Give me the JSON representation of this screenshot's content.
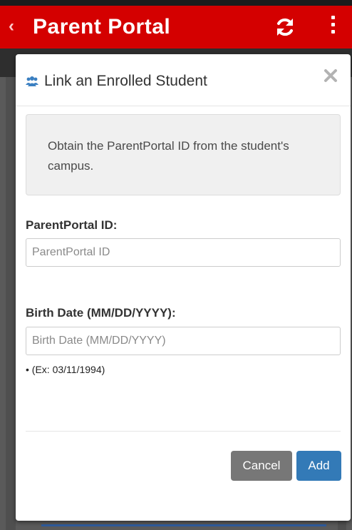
{
  "appbar": {
    "back_icon": "chevron-left-icon",
    "title": "Parent Portal",
    "refresh_icon": "refresh-icon",
    "menu_icon": "more-vertical-icon",
    "background_color": "#d40000"
  },
  "modal": {
    "header_icon": "users-icon",
    "title": "Link an Enrolled Student",
    "close_icon": "close-icon",
    "info_text": "Obtain the ParentPortal ID from the student's campus.",
    "fields": [
      {
        "label": "ParentPortal ID:",
        "placeholder": "ParentPortal ID",
        "value": ""
      },
      {
        "label": "Birth Date (MM/DD/YYYY):",
        "placeholder": "Birth Date (MM/DD/YYYY)",
        "value": ""
      }
    ],
    "hints": [
      "(Ex: 03/11/1994)"
    ],
    "buttons": {
      "cancel": "Cancel",
      "add": "Add"
    },
    "colors": {
      "cancel": "#777777",
      "add": "#337ab7"
    }
  }
}
